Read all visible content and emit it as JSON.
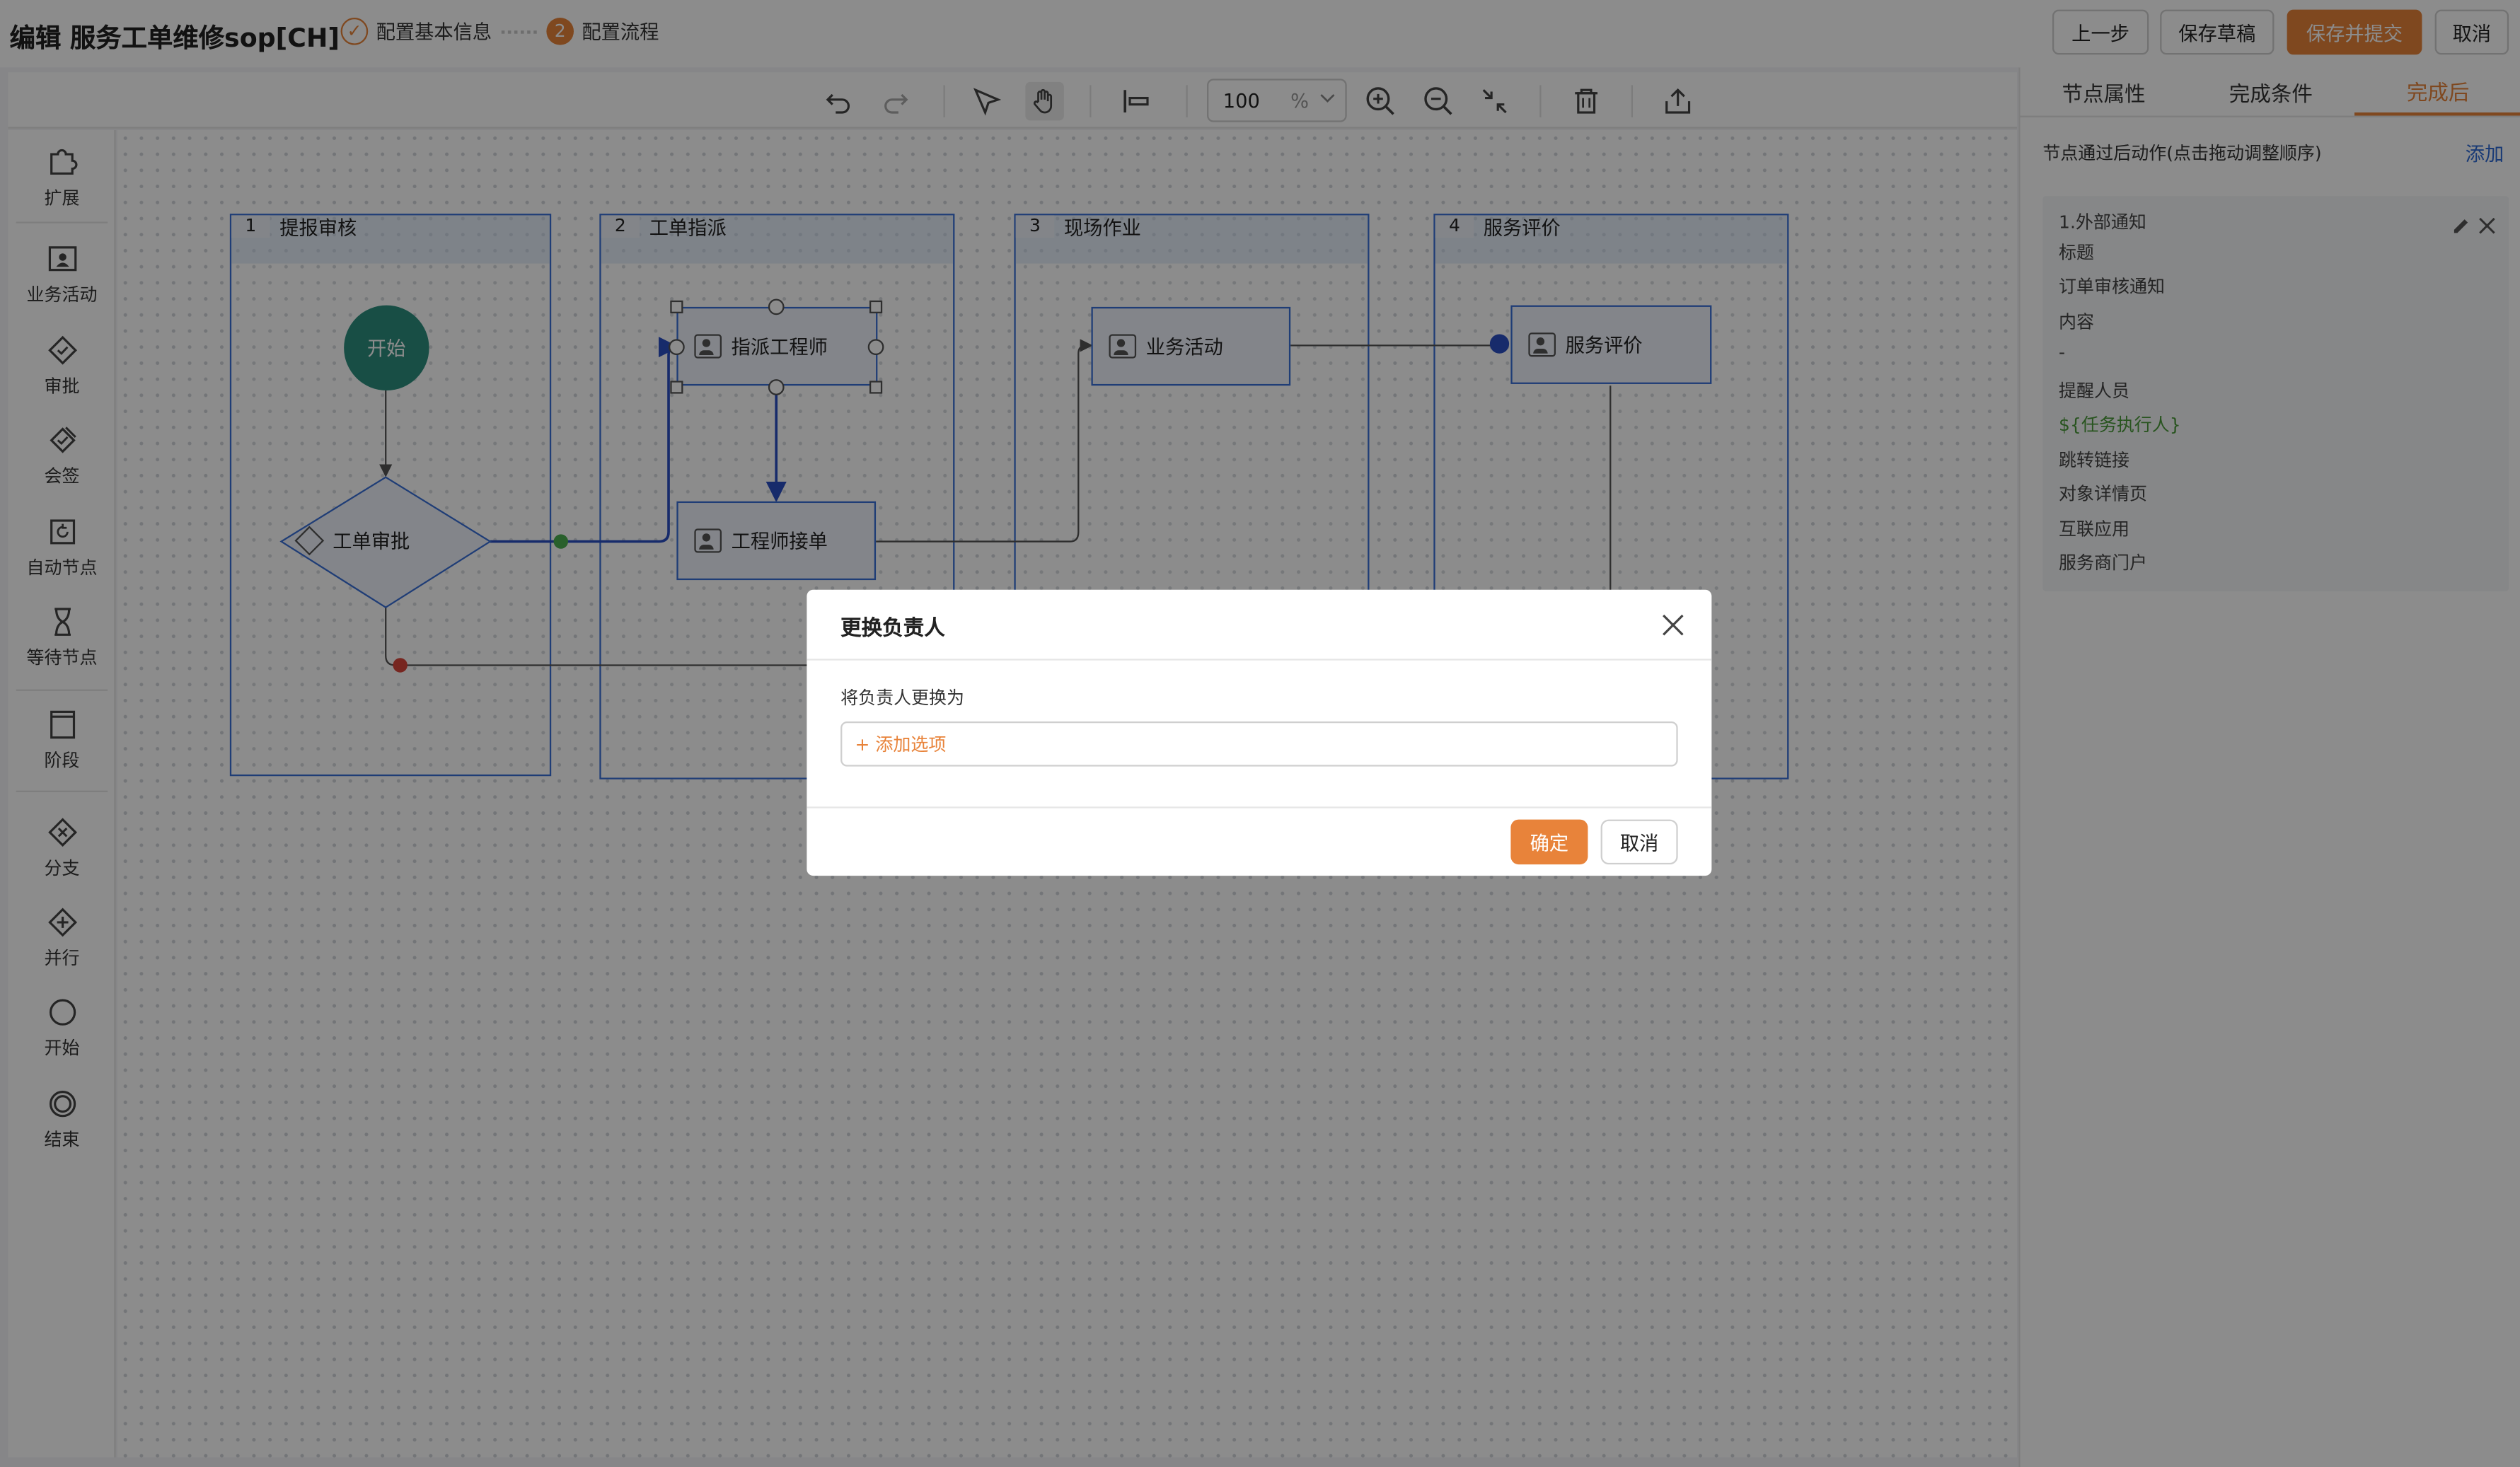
{
  "header": {
    "title": "编辑 服务工单维修sop[CH]",
    "steps": [
      {
        "num": "✓",
        "label": "配置基本信息"
      },
      {
        "num": "2",
        "label": "配置流程"
      }
    ],
    "buttons": {
      "prev": "上一步",
      "save_draft": "保存草稿",
      "save_submit": "保存并提交",
      "cancel": "取消"
    }
  },
  "palette": {
    "items": [
      "扩展",
      "业务活动",
      "审批",
      "会签",
      "自动节点",
      "等待节点",
      "阶段",
      "分支",
      "并行",
      "开始",
      "结束"
    ]
  },
  "toolbar": {
    "icons": [
      "undo-icon",
      "redo-icon",
      "pointer-icon",
      "hand-icon",
      "align-icon",
      "zoom-in-icon",
      "zoom-out-icon",
      "fit-icon",
      "delete-icon",
      "export-icon"
    ],
    "zoom_value": "100",
    "zoom_unit": "%"
  },
  "canvas": {
    "lanes": [
      {
        "num": "1",
        "title": "提报审核"
      },
      {
        "num": "2",
        "title": "工单指派"
      },
      {
        "num": "3",
        "title": "现场作业"
      },
      {
        "num": "4",
        "title": "服务评价"
      }
    ],
    "nodes": {
      "start": "开始",
      "approval": "工单审批",
      "assign": "指派工程师",
      "accept": "工程师接单",
      "activity": "业务活动",
      "evaluate": "服务评价"
    }
  },
  "right_panel": {
    "tabs": [
      "节点属性",
      "完成条件",
      "完成后"
    ],
    "active_tab": "完成后",
    "description": "节点通过后动作(点击拖动调整顺序)",
    "add_label": "添加",
    "action": {
      "rows": [
        "1.外部通知",
        "标题",
        "订单审核通知",
        "内容",
        "-",
        "提醒人员",
        "${任务执行人}",
        "跳转链接",
        "对象详情页",
        "互联应用",
        "服务商门户"
      ]
    }
  },
  "modal": {
    "title": "更换负责人",
    "label": "将负责人更换为",
    "input_placeholder": "+ 添加选项",
    "ok": "确定",
    "cancel": "取消"
  },
  "colors": {
    "accent": "#e8833a",
    "lane_border": "#3a6fd8",
    "start_node": "#2c8f7e",
    "link_blue": "#2f6bd6",
    "variable_green": "#4a9a3a"
  }
}
